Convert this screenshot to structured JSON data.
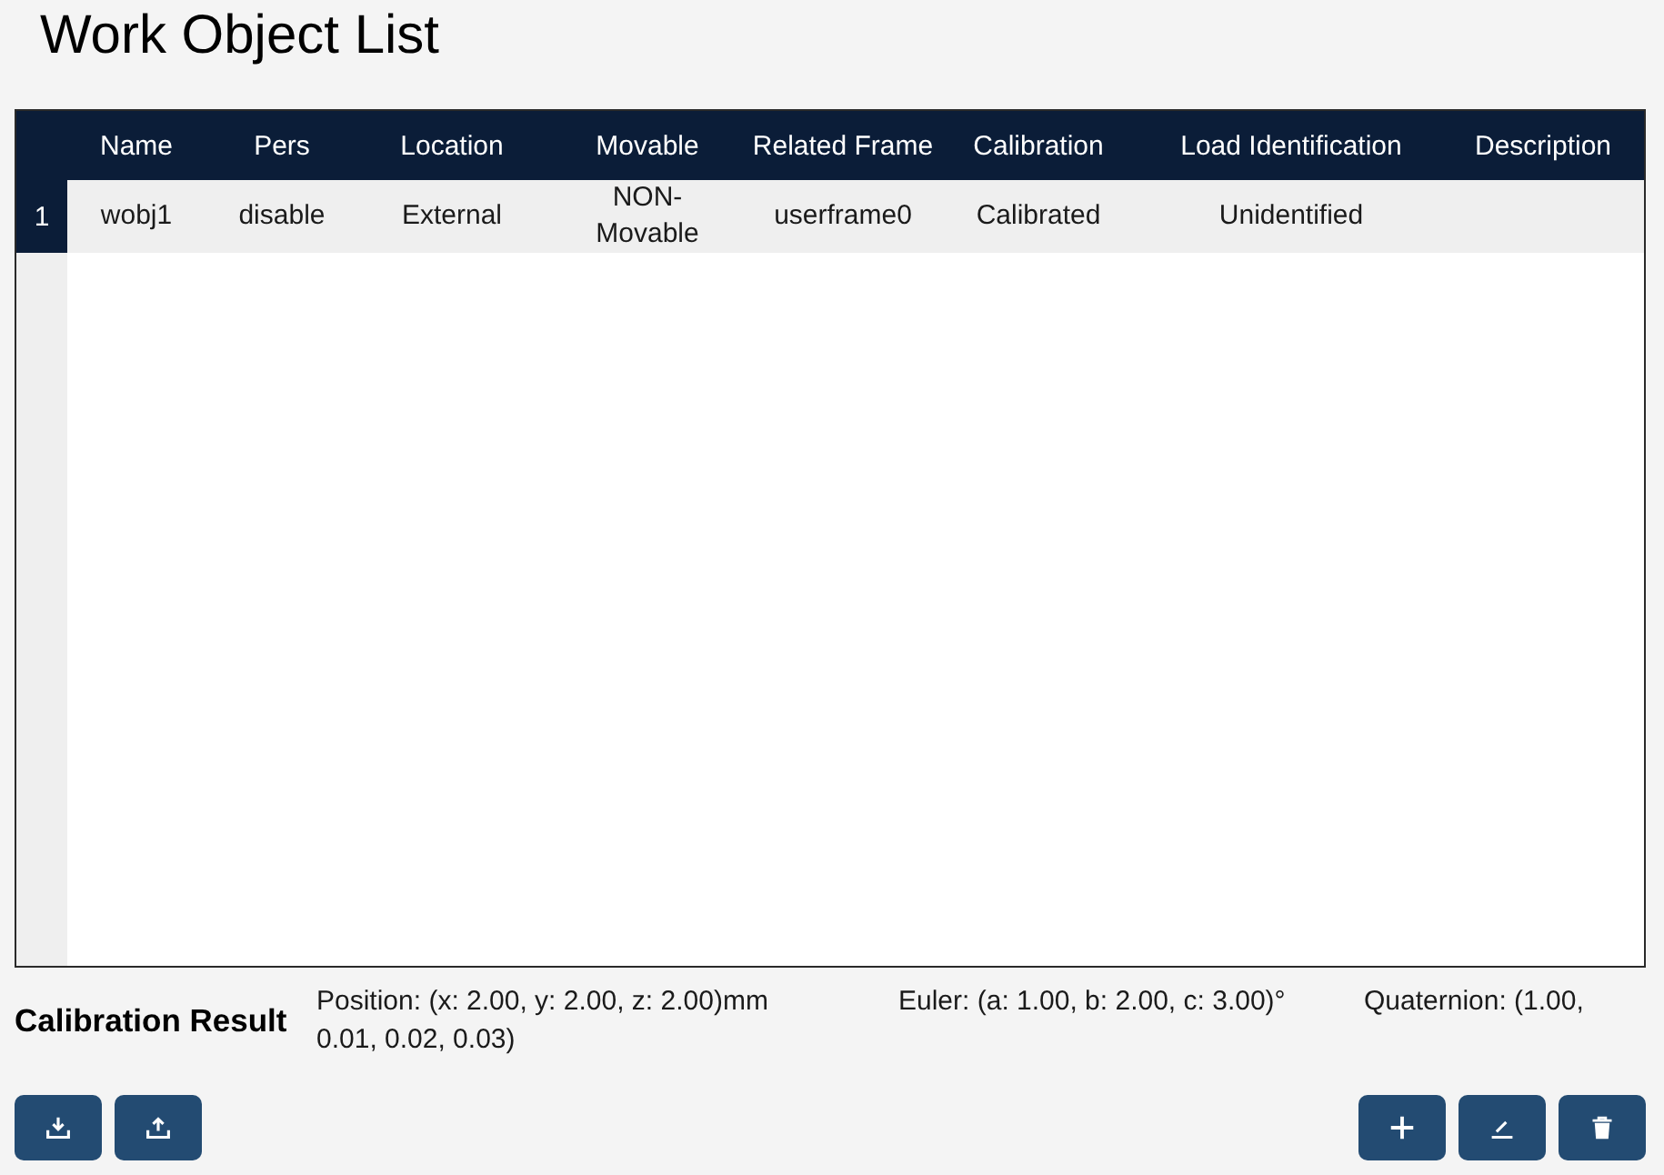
{
  "title": "Work Object List",
  "table": {
    "columns": [
      "Name",
      "Pers",
      "Location",
      "Movable",
      "Related Frame",
      "Calibration",
      "Load Identification",
      "Description"
    ],
    "rows": [
      {
        "index": "1",
        "selected": true,
        "cells": [
          "wobj1",
          "disable",
          "External",
          "NON-Movable",
          "userframe0",
          "Calibrated",
          "Unidentified"
        ]
      }
    ]
  },
  "calibration": {
    "label": "Calibration Result",
    "position": "Position: (x: 2.00, y: 2.00, z: 2.00)mm",
    "euler": "Euler: (a: 1.00, b: 2.00, c: 3.00)°",
    "quaternion": "Quaternion: (1.00, 0.01, 0.02, 0.03)"
  },
  "toolbar": {
    "left": [
      {
        "kind": "download"
      },
      {
        "kind": "upload"
      }
    ],
    "right": [
      {
        "kind": "add"
      },
      {
        "kind": "edit"
      },
      {
        "kind": "delete"
      }
    ]
  }
}
